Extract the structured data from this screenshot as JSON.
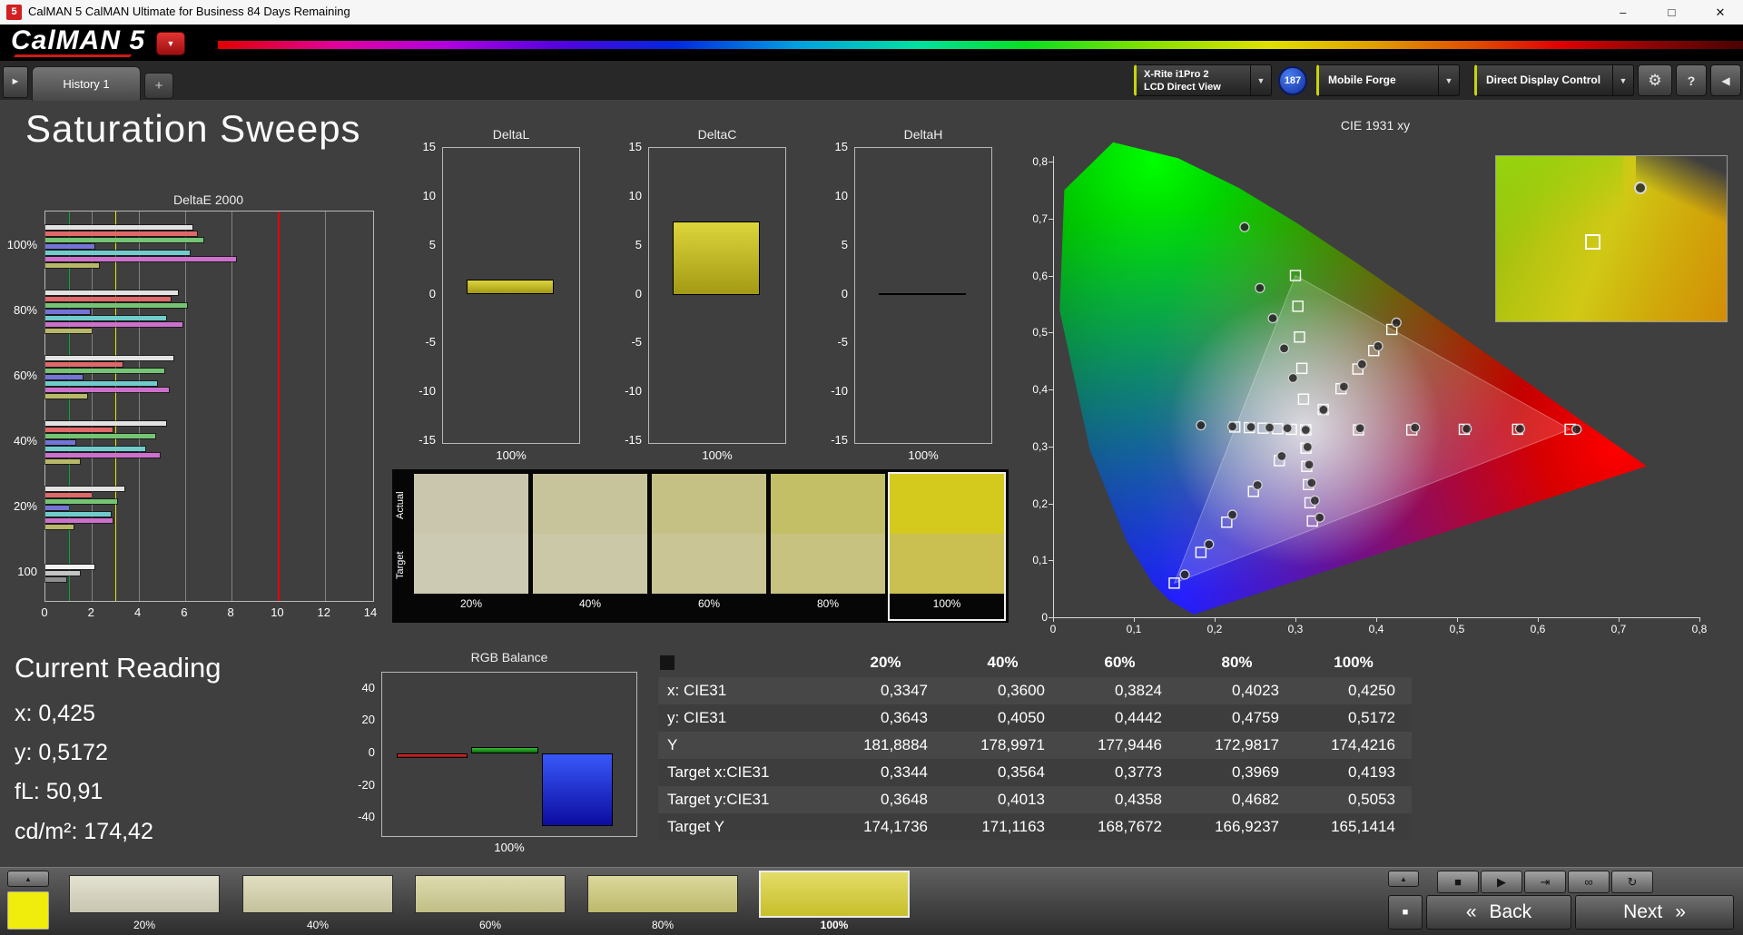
{
  "window": {
    "title": "CalMAN 5 CalMAN Ultimate for Business 84 Days Remaining"
  },
  "logo": {
    "name": "CalMAN 5"
  },
  "nav": {
    "history_tab": "History 1",
    "add_tab": "+"
  },
  "toolbar": {
    "meter_line1": "X-Rite i1Pro 2",
    "meter_line2": "LCD Direct View",
    "badge": "187",
    "pattern_source": "Mobile Forge",
    "display_control": "Direct Display Control"
  },
  "icons": {
    "minimize": "–",
    "maximize": "□",
    "close": "✕",
    "down_arrow": "▼",
    "right_arrow": "►",
    "left_arrow": "◀",
    "gear": "⚙",
    "help": "?",
    "expand": "▲",
    "back_chev": "«",
    "next_chev": "»",
    "square": "■"
  },
  "page_title": "Saturation Sweeps",
  "current_reading": {
    "heading": "Current Reading",
    "lines": [
      "x: 0,425",
      "y: 0,5172",
      "fL: 50,91",
      "cd/m²: 174,42"
    ]
  },
  "swatch_strip": {
    "row_labels": [
      "Actual",
      "Target"
    ],
    "columns": [
      {
        "label": "20%",
        "actual": "#c9c6ad",
        "target": "#cdcab4",
        "selected": false
      },
      {
        "label": "40%",
        "actual": "#c7c39b",
        "target": "#cbc8a7",
        "selected": false
      },
      {
        "label": "60%",
        "actual": "#c5c185",
        "target": "#c9c595",
        "selected": false
      },
      {
        "label": "80%",
        "actual": "#c3bf67",
        "target": "#c7c27f",
        "selected": false
      },
      {
        "label": "100%",
        "actual": "#d4ca1d",
        "target": "#c9c051",
        "selected": true
      }
    ]
  },
  "bottom_bar": {
    "swatches": [
      {
        "label": "20%",
        "color": "#d9d6bf",
        "selected": false
      },
      {
        "label": "40%",
        "color": "#d5d2a9",
        "selected": false
      },
      {
        "label": "60%",
        "color": "#d1ce91",
        "selected": false
      },
      {
        "label": "80%",
        "color": "#cdc975",
        "selected": false
      },
      {
        "label": "100%",
        "color": "#d8cf2e",
        "selected": true
      }
    ],
    "transport": [
      {
        "name": "stop",
        "glyph": "■"
      },
      {
        "name": "play",
        "glyph": "▶"
      },
      {
        "name": "step",
        "glyph": "⇥"
      },
      {
        "name": "continuous",
        "glyph": "∞"
      },
      {
        "name": "loop",
        "glyph": "↻"
      }
    ],
    "back": "Back",
    "next": "Next"
  },
  "chart_data": [
    {
      "id": "deltae2000",
      "type": "bar",
      "orientation": "horizontal",
      "title": "DeltaE 2000",
      "xlim": [
        0,
        14
      ],
      "xticks": [
        0,
        2,
        4,
        6,
        8,
        10,
        12,
        14
      ],
      "reference_lines": [
        {
          "value": 1,
          "color": "#00a83c",
          "w": 1
        },
        {
          "value": 3,
          "color": "#e6e600",
          "w": 1
        },
        {
          "value": 10,
          "color": "#e60000",
          "w": 2
        }
      ],
      "groups": [
        {
          "label": "100%",
          "bars": [
            {
              "color": "#e2e2e2",
              "value": 6.3
            },
            {
              "color": "#e06868",
              "value": 6.5
            },
            {
              "color": "#74c474",
              "value": 6.8
            },
            {
              "color": "#7474d8",
              "value": 2.1
            },
            {
              "color": "#70cccc",
              "value": 6.2
            },
            {
              "color": "#cc70cc",
              "value": 8.2
            },
            {
              "color": "#b8b868",
              "value": 2.3
            }
          ]
        },
        {
          "label": "80%",
          "bars": [
            {
              "color": "#e2e2e2",
              "value": 5.7
            },
            {
              "color": "#e06868",
              "value": 5.4
            },
            {
              "color": "#74c474",
              "value": 6.1
            },
            {
              "color": "#7474d8",
              "value": 1.9
            },
            {
              "color": "#70cccc",
              "value": 5.2
            },
            {
              "color": "#cc70cc",
              "value": 5.9
            },
            {
              "color": "#b8b868",
              "value": 2.0
            }
          ]
        },
        {
          "label": "60%",
          "bars": [
            {
              "color": "#e2e2e2",
              "value": 5.5
            },
            {
              "color": "#e06868",
              "value": 3.3
            },
            {
              "color": "#74c474",
              "value": 5.1
            },
            {
              "color": "#7474d8",
              "value": 1.6
            },
            {
              "color": "#70cccc",
              "value": 4.8
            },
            {
              "color": "#cc70cc",
              "value": 5.3
            },
            {
              "color": "#b8b868",
              "value": 1.8
            }
          ]
        },
        {
          "label": "40%",
          "bars": [
            {
              "color": "#e2e2e2",
              "value": 5.2
            },
            {
              "color": "#e06868",
              "value": 2.9
            },
            {
              "color": "#74c474",
              "value": 4.7
            },
            {
              "color": "#7474d8",
              "value": 1.3
            },
            {
              "color": "#70cccc",
              "value": 4.3
            },
            {
              "color": "#cc70cc",
              "value": 4.9
            },
            {
              "color": "#b8b868",
              "value": 1.5
            }
          ]
        },
        {
          "label": "20%",
          "bars": [
            {
              "color": "#e2e2e2",
              "value": 3.4
            },
            {
              "color": "#e06868",
              "value": 2.0
            },
            {
              "color": "#74c474",
              "value": 3.1
            },
            {
              "color": "#7474d8",
              "value": 1.0
            },
            {
              "color": "#70cccc",
              "value": 2.8
            },
            {
              "color": "#cc70cc",
              "value": 2.9
            },
            {
              "color": "#b8b868",
              "value": 1.2
            }
          ]
        },
        {
          "label": "100",
          "bars": [
            {
              "color": "#f2f2f2",
              "value": 2.1
            },
            {
              "color": "#c4c4c4",
              "value": 1.5
            },
            {
              "color": "#8e8e8e",
              "value": 0.9
            }
          ]
        }
      ]
    },
    {
      "id": "deltaL",
      "type": "bar",
      "title": "DeltaL",
      "ylim": [
        -15,
        15
      ],
      "yticks": [
        15,
        10,
        5,
        0,
        -5,
        -10,
        -15
      ],
      "categories": [
        "100%"
      ],
      "values": [
        1.5
      ],
      "bar_color": "#a39a15",
      "bar_color_light": "#ddd53b"
    },
    {
      "id": "deltaC",
      "type": "bar",
      "title": "DeltaC",
      "ylim": [
        -15,
        15
      ],
      "yticks": [
        15,
        10,
        5,
        0,
        -5,
        -10,
        -15
      ],
      "categories": [
        "100%"
      ],
      "values": [
        7.5
      ],
      "bar_color": "#a39a15",
      "bar_color_light": "#ddd53b"
    },
    {
      "id": "deltaH",
      "type": "bar",
      "title": "DeltaH",
      "ylim": [
        -15,
        15
      ],
      "yticks": [
        15,
        10,
        5,
        0,
        -5,
        -10,
        -15
      ],
      "categories": [
        "100%"
      ],
      "values": [
        0.15
      ],
      "bar_color": "#b8b018",
      "bar_color_light": "#d8d020"
    },
    {
      "id": "rgb_balance",
      "type": "bar",
      "title": "RGB Balance",
      "ylim": [
        -50,
        50
      ],
      "yticks": [
        40,
        20,
        0,
        -20,
        -40
      ],
      "categories": [
        "100%"
      ],
      "series": [
        {
          "name": "Red",
          "color": "#ee3030",
          "color2": "#8c0c0c",
          "value": -3
        },
        {
          "name": "Green",
          "color": "#38b838",
          "color2": "#0c6c0c",
          "value": 4
        },
        {
          "name": "Blue",
          "color": "#3858f8",
          "color2": "#0c0ca0",
          "value": -45
        }
      ]
    },
    {
      "id": "cie1931",
      "type": "scatter",
      "title": "CIE 1931 xy",
      "xlim": [
        0,
        0.8
      ],
      "ylim": [
        0,
        0.8
      ],
      "xtick_labels": [
        "0",
        "0,1",
        "0,2",
        "0,3",
        "0,4",
        "0,5",
        "0,6",
        "0,7",
        "0,8"
      ],
      "ytick_labels": [
        "0",
        "0,1",
        "0,2",
        "0,3",
        "0,4",
        "0,5",
        "0,6",
        "0,7",
        "0,8"
      ],
      "series": [
        {
          "name": "targets",
          "marker": "square",
          "points": [
            [
              0.3127,
              0.329
            ],
            [
              0.378,
              0.329
            ],
            [
              0.444,
              0.329
            ],
            [
              0.509,
              0.33
            ],
            [
              0.575,
              0.33
            ],
            [
              0.64,
              0.33
            ],
            [
              0.31,
              0.383
            ],
            [
              0.308,
              0.437
            ],
            [
              0.305,
              0.492
            ],
            [
              0.303,
              0.546
            ],
            [
              0.3,
              0.6
            ],
            [
              0.28,
              0.275
            ],
            [
              0.248,
              0.221
            ],
            [
              0.215,
              0.167
            ],
            [
              0.183,
              0.114
            ],
            [
              0.15,
              0.06
            ],
            [
              0.295,
              0.33
            ],
            [
              0.278,
              0.331
            ],
            [
              0.26,
              0.332
            ],
            [
              0.243,
              0.333
            ],
            [
              0.225,
              0.334
            ],
            [
              0.313,
              0.297
            ],
            [
              0.314,
              0.265
            ],
            [
              0.316,
              0.233
            ],
            [
              0.318,
              0.201
            ],
            [
              0.321,
              0.169
            ],
            [
              0.3344,
              0.3648
            ],
            [
              0.3564,
              0.4013
            ],
            [
              0.3773,
              0.4358
            ],
            [
              0.3969,
              0.4682
            ],
            [
              0.4193,
              0.5053
            ]
          ]
        },
        {
          "name": "measured",
          "marker": "circle",
          "points": [
            [
              0.3127,
              0.329
            ],
            [
              0.38,
              0.332
            ],
            [
              0.448,
              0.333
            ],
            [
              0.512,
              0.331
            ],
            [
              0.578,
              0.331
            ],
            [
              0.648,
              0.33
            ],
            [
              0.297,
              0.42
            ],
            [
              0.286,
              0.472
            ],
            [
              0.272,
              0.525
            ],
            [
              0.256,
              0.578
            ],
            [
              0.237,
              0.685
            ],
            [
              0.283,
              0.283
            ],
            [
              0.253,
              0.232
            ],
            [
              0.222,
              0.18
            ],
            [
              0.193,
              0.128
            ],
            [
              0.163,
              0.075
            ],
            [
              0.29,
              0.332
            ],
            [
              0.268,
              0.333
            ],
            [
              0.245,
              0.334
            ],
            [
              0.222,
              0.335
            ],
            [
              0.183,
              0.337
            ],
            [
              0.315,
              0.299
            ],
            [
              0.317,
              0.268
            ],
            [
              0.32,
              0.236
            ],
            [
              0.324,
              0.205
            ],
            [
              0.33,
              0.175
            ],
            [
              0.3347,
              0.3643
            ],
            [
              0.36,
              0.405
            ],
            [
              0.3824,
              0.4442
            ],
            [
              0.4023,
              0.4759
            ],
            [
              0.425,
              0.5172
            ]
          ]
        }
      ]
    },
    {
      "id": "results_table",
      "type": "table",
      "columns": [
        "",
        "20%",
        "40%",
        "60%",
        "80%",
        "100%"
      ],
      "rows": [
        [
          "x: CIE31",
          "0,3347",
          "0,3600",
          "0,3824",
          "0,4023",
          "0,4250"
        ],
        [
          "y: CIE31",
          "0,3643",
          "0,4050",
          "0,4442",
          "0,4759",
          "0,5172"
        ],
        [
          "Y",
          "181,8884",
          "178,9971",
          "177,9446",
          "172,9817",
          "174,4216"
        ],
        [
          "Target x:CIE31",
          "0,3344",
          "0,3564",
          "0,3773",
          "0,3969",
          "0,4193"
        ],
        [
          "Target y:CIE31",
          "0,3648",
          "0,4013",
          "0,4358",
          "0,4682",
          "0,5053"
        ],
        [
          "Target Y",
          "174,1736",
          "171,1163",
          "168,7672",
          "166,9237",
          "165,1414"
        ]
      ]
    }
  ]
}
